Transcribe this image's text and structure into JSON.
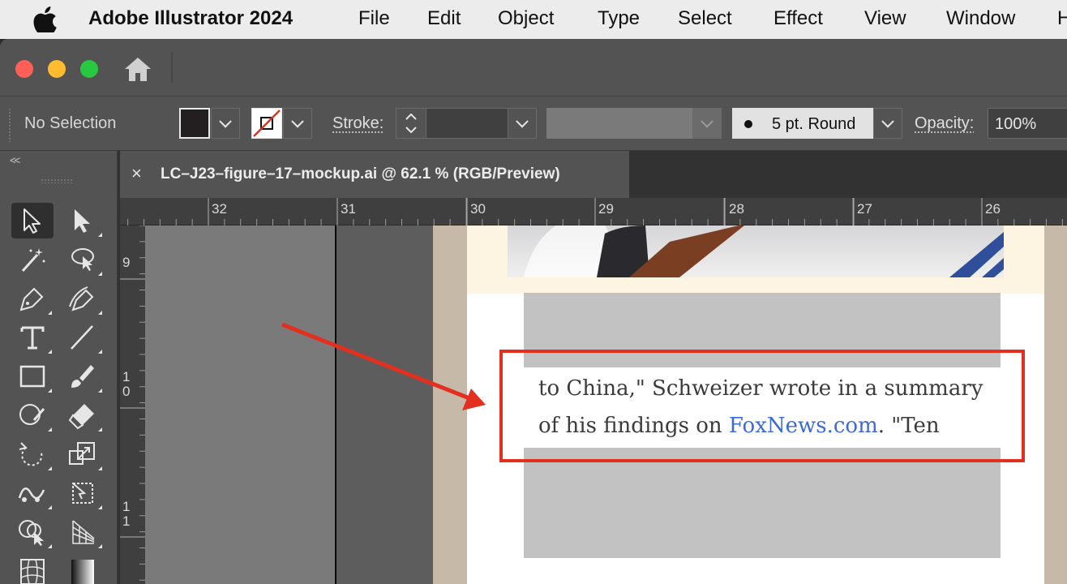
{
  "menubar": {
    "app_name": "Adobe Illustrator 2024",
    "items": [
      "File",
      "Edit",
      "Object",
      "Type",
      "Select",
      "Effect",
      "View",
      "Window",
      "H"
    ]
  },
  "control_bar": {
    "selection_label": "No Selection",
    "stroke_label": "Stroke:",
    "stroke_value": "",
    "brush_label": "5 pt. Round",
    "opacity_label": "Opacity:",
    "opacity_value": "100%"
  },
  "toolbar": {
    "collapse_label": "<<",
    "tools": [
      "selection-tool",
      "direct-selection-tool",
      "magic-wand-tool",
      "lasso-tool",
      "pen-tool",
      "curvature-tool",
      "type-tool",
      "line-segment-tool",
      "rectangle-tool",
      "paintbrush-tool",
      "shaper-tool",
      "eraser-tool",
      "rotate-tool",
      "scale-tool",
      "puppet-warp-tool",
      "free-transform-tool",
      "shape-builder-tool",
      "perspective-grid-tool",
      "mesh-tool",
      "gradient-tool"
    ]
  },
  "document": {
    "close_symbol": "×",
    "tab_title": "LC–J23–figure–17–mockup.ai @ 62.1 % (RGB/Preview)"
  },
  "rulers": {
    "top": [
      "32",
      "31",
      "30",
      "29",
      "28",
      "27",
      "26"
    ],
    "left": [
      "9",
      "1\n0",
      "1\n1"
    ]
  },
  "canvas": {
    "article_line1": "to China,\" Schweizer wrote in a summary",
    "article_line2_before": "of his findings on ",
    "article_link": "FoxNews.com",
    "article_line2_after": ". \"Ten"
  },
  "colors": {
    "annotation": "#e32f1f",
    "link": "#3c6ad6",
    "fill_swatch": "#231f20"
  }
}
